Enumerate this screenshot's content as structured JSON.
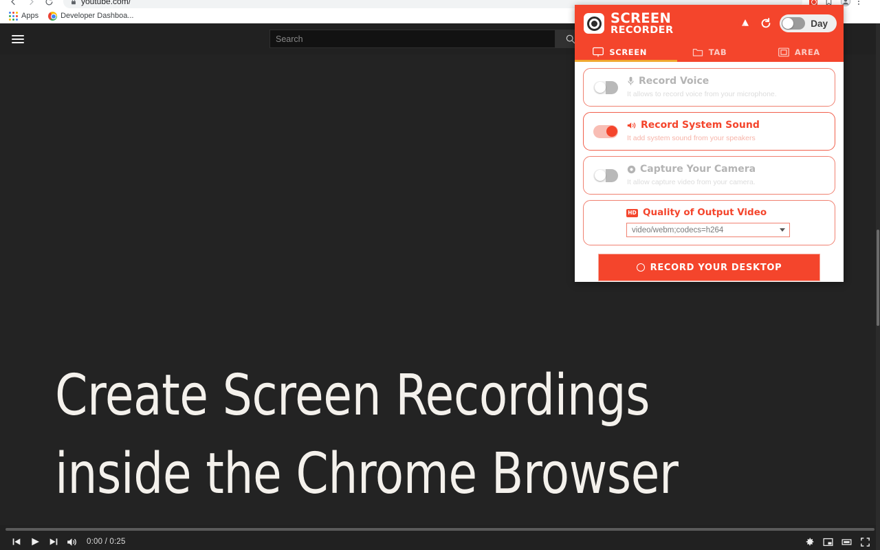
{
  "browser": {
    "nav": {
      "back_icon": "back-arrow-icon",
      "forward_icon": "forward-arrow-icon",
      "reload_icon": "reload-icon"
    },
    "omnibox": {
      "url": "youtube.com/",
      "lock_icon": "lock-icon"
    },
    "toolbar_icons": {
      "extension": "screen-recorder-extension-icon",
      "bookmark_star": "bookmark-star-icon",
      "profile": "profile-avatar-icon",
      "menu": "chrome-menu-icon"
    },
    "bookmarks": {
      "apps_label": "Apps",
      "items": [
        {
          "label": "Developer Dashboa...",
          "icon": "chrome-icon"
        }
      ]
    }
  },
  "youtube": {
    "hamburger_icon": "hamburger-menu-icon",
    "search": {
      "placeholder": "Search",
      "value": "",
      "button_icon": "search-icon"
    },
    "video_title_lines": [
      "Create Screen Recordings",
      "inside the Chrome Browser"
    ],
    "player": {
      "prev_icon": "previous-track-icon",
      "play_icon": "play-icon",
      "next_icon": "next-track-icon",
      "volume_icon": "volume-icon",
      "time": "0:00 / 0:25",
      "current_time": "0:00",
      "duration": "0:25",
      "progress_percent": 0,
      "settings_icon": "gear-icon",
      "miniplayer_icon": "miniplayer-icon",
      "theater_icon": "theater-mode-icon",
      "fullscreen_icon": "fullscreen-icon"
    }
  },
  "popup": {
    "brand": {
      "line1": "SCREEN",
      "line2": "RECORDER",
      "logo_icon": "record-logo-icon"
    },
    "header_actions": {
      "drive_icon": "google-drive-icon",
      "history_icon": "refresh-history-icon",
      "theme_toggle": {
        "label": "Day",
        "state": "off"
      }
    },
    "tabs": [
      {
        "label": "SCREEN",
        "icon": "monitor-icon",
        "active": true
      },
      {
        "label": "TAB",
        "icon": "folder-tab-icon",
        "active": false
      },
      {
        "label": "AREA",
        "icon": "area-select-icon",
        "active": false
      }
    ],
    "options": [
      {
        "title": "Record Voice",
        "subtitle": "It allows to record voice from your microphone.",
        "icon": "microphone-icon",
        "enabled": false
      },
      {
        "title": "Record System Sound",
        "subtitle": "It add system sound from your speakers",
        "icon": "speaker-icon",
        "enabled": true
      },
      {
        "title": "Capture Your Camera",
        "subtitle": "It allow capture video from your camera.",
        "icon": "camera-icon",
        "enabled": false
      }
    ],
    "quality": {
      "title": "Quality of Output Video",
      "badge": "HD",
      "selected": "video/webm;codecs=h264"
    },
    "record_button": {
      "label": "RECORD YOUR DESKTOP",
      "icon": "record-circle-icon"
    },
    "colors": {
      "brand_red": "#f4452c",
      "accent_underline": "#f0a830",
      "muted_gray": "#b4b4b4"
    }
  }
}
